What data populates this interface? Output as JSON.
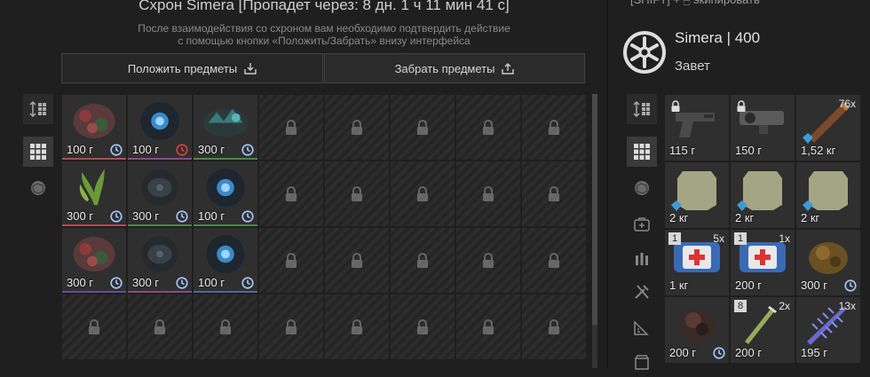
{
  "stash": {
    "title": "Схрон Simera [Пропадет через: 8 дн. 1 ч 11 мин 41 с]",
    "subtitle_line1": "После взаимодействия со схроном вам необходимо подтвердить действие",
    "subtitle_line2": "с помощью кнопки «Положить/Забрать» внизу интерфейса",
    "put_label": "Положить предметы",
    "take_label": "Забрать предметы",
    "items": [
      {
        "weight": "100 г",
        "timer": "normal",
        "bar": "#b04a55",
        "art": "red-artifact"
      },
      {
        "weight": "100 г",
        "timer": "alert",
        "bar": "#8a4a8a",
        "art": "blue-orb"
      },
      {
        "weight": "300 г",
        "timer": "normal",
        "bar": "#4a8a4a",
        "art": "teal-crystal"
      },
      {
        "weight": "300 г",
        "timer": "normal",
        "bar": "#b04a55",
        "art": "green-plant"
      },
      {
        "weight": "300 г",
        "timer": "normal",
        "bar": "#4a8a4a",
        "art": "dark-orb"
      },
      {
        "weight": "100 г",
        "timer": "normal",
        "bar": "#4a8a4a",
        "art": "blue-orb"
      },
      {
        "weight": "300 г",
        "timer": "normal",
        "bar": "#6a4a9a",
        "art": "red-artifact"
      },
      {
        "weight": "300 г",
        "timer": "normal",
        "bar": "#8a4a8a",
        "art": "dark-orb"
      },
      {
        "weight": "100 г",
        "timer": "normal",
        "bar": "#4a6a9a",
        "art": "blue-orb"
      }
    ]
  },
  "character": {
    "hint": "[SHIFT] + 🖱 экипировать",
    "name": "Simera | 400",
    "faction": "Завет",
    "items": [
      {
        "weight": "115 г",
        "locked": true,
        "art": "handgun"
      },
      {
        "weight": "150 г",
        "locked": true,
        "art": "scope"
      },
      {
        "weight": "1,52 кг",
        "count": "76x",
        "gem": true,
        "art": "ammo"
      },
      {
        "weight": "2 кг",
        "gem": true,
        "art": "plate"
      },
      {
        "weight": "2 кг",
        "gem": true,
        "art": "plate"
      },
      {
        "weight": "2 кг",
        "gem": true,
        "art": "plate"
      },
      {
        "weight": "1 кг",
        "count": "5x",
        "qbadge": "1",
        "art": "medkit"
      },
      {
        "weight": "200 г",
        "count": "1x",
        "qbadge": "1",
        "art": "medkit"
      },
      {
        "weight": "300 г",
        "timer": "normal",
        "art": "brown-artifact"
      },
      {
        "weight": "200 г",
        "timer": "normal",
        "art": "dark-artifact"
      },
      {
        "weight": "200 г",
        "count": "2x",
        "qbadge": "8",
        "art": "syringe"
      },
      {
        "weight": "195 г",
        "count": "13x",
        "art": "spiky"
      }
    ]
  },
  "colors": {
    "accent_alert": "#e04040",
    "clock": "#a8c8ff"
  }
}
